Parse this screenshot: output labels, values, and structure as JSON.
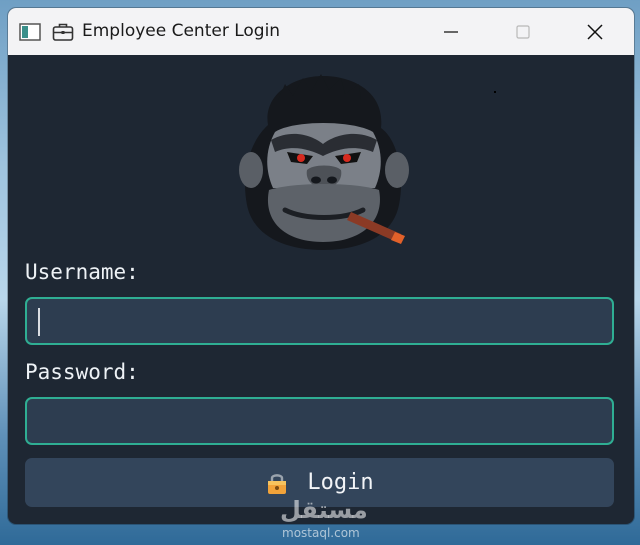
{
  "window": {
    "title": "Employee Center Login",
    "icons": [
      "app-window-icon",
      "briefcase-icon"
    ],
    "controls": [
      "minimize-icon",
      "maximize-icon",
      "close-icon"
    ]
  },
  "logo": {
    "icon": "gorilla-logo"
  },
  "form": {
    "username_label": "Username:",
    "username_value": "",
    "password_label": "Password:",
    "password_value": ""
  },
  "login_button": {
    "icon": "lock-icon",
    "label": "Login"
  },
  "watermark": {
    "arabic": "مستقل",
    "latin": "mostaql.com"
  },
  "colors": {
    "window_bg": "#1e2733",
    "field_bg": "#2d3d50",
    "field_border": "#2fae93",
    "button_bg": "#33455b",
    "titlebar_bg": "#f3f3f5"
  }
}
